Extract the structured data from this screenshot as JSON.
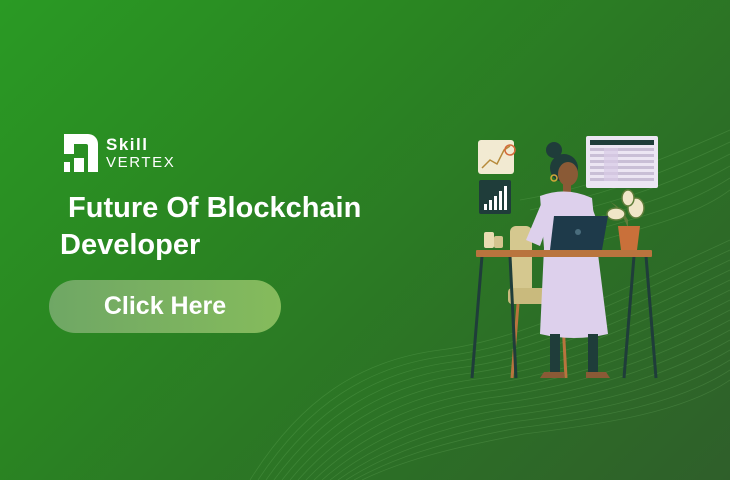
{
  "logo": {
    "word1": "Skill",
    "word2": "VERTEX"
  },
  "headline": {
    "line1": " Future Of Blockchain",
    "line2": "Developer"
  },
  "cta": {
    "label": "Click Here"
  },
  "colors": {
    "background_start": "#2a9a24",
    "background_end": "#2f5f2a",
    "button": "#7bb260",
    "text": "#ffffff",
    "dress": "#ddd0ec",
    "desk": "#b9743e",
    "laptop": "#1e3a4a",
    "plant_pot": "#c9703a"
  },
  "icons": [
    "logo-icon",
    "growth-chart-icon",
    "bar-chart-icon",
    "spreadsheet-icon",
    "laptop-icon",
    "plant-icon",
    "mug-icon"
  ]
}
